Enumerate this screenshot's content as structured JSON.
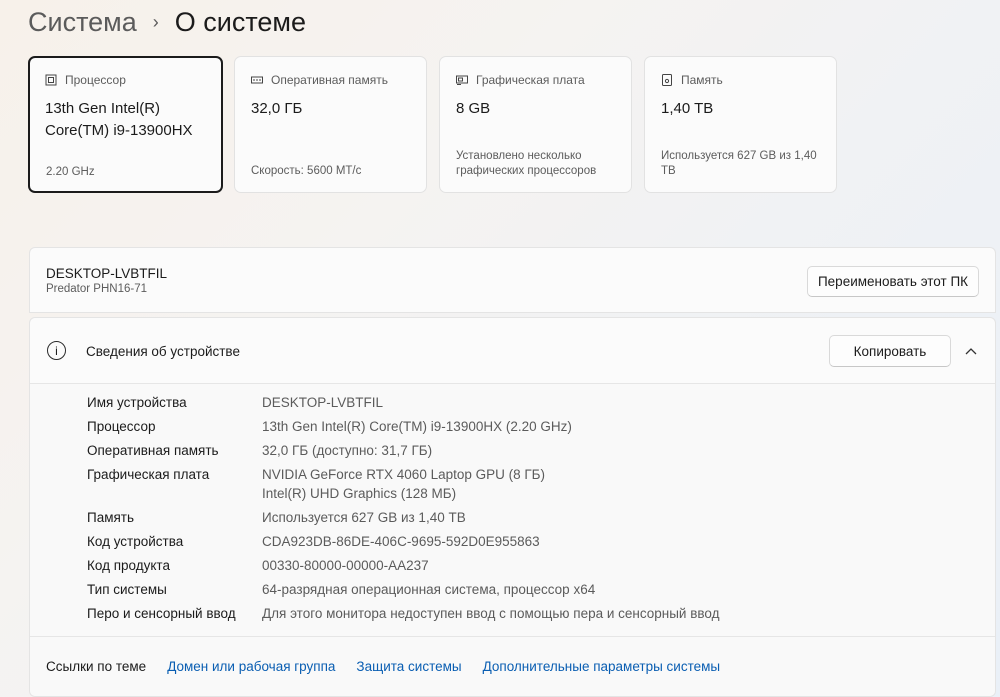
{
  "breadcrumb": {
    "parent": "Система",
    "separator": "›",
    "current": "О системе"
  },
  "specs_cards": [
    {
      "label": "Процессор",
      "icon": "cpu-icon",
      "value_line1": "13th Gen Intel(R)",
      "value_line2": "Core(TM) i9-13900HX",
      "sub_line1": "2.20 GHz",
      "sub_line2": ""
    },
    {
      "label": "Оперативная память",
      "icon": "ram-icon",
      "value_line1": "32,0 ГБ",
      "value_line2": "",
      "sub_line1": "Скорость: 5600 МТ/с",
      "sub_line2": ""
    },
    {
      "label": "Графическая плата",
      "icon": "gpu-icon",
      "value_line1": "8 GB",
      "value_line2": "",
      "sub_line1": "Установлено несколько",
      "sub_line2": "графических процессоров"
    },
    {
      "label": "Память",
      "icon": "storage-icon",
      "value_line1": "1,40 TB",
      "value_line2": "",
      "sub_line1": "Используется 627 GB из 1,40",
      "sub_line2": "TB"
    }
  ],
  "device": {
    "name": "DESKTOP-LVBTFIL",
    "model": "Predator PHN16-71",
    "rename_label": "Переименовать этот ПК"
  },
  "device_info": {
    "title": "Сведения об устройстве",
    "copy_label": "Копировать",
    "rows": [
      {
        "key": "Имя устройства",
        "value": "DESKTOP-LVBTFIL",
        "value2": ""
      },
      {
        "key": "Процессор",
        "value": "13th Gen Intel(R) Core(TM) i9-13900HX (2.20 GHz)",
        "value2": ""
      },
      {
        "key": "Оперативная память",
        "value": "32,0 ГБ (доступно: 31,7 ГБ)",
        "value2": ""
      },
      {
        "key": "Графическая плата",
        "value": "NVIDIA GeForce RTX 4060 Laptop GPU (8 ГБ)",
        "value2": "Intel(R) UHD Graphics (128 МБ)"
      },
      {
        "key": "Память",
        "value": "Используется 627 GB из 1,40 TB",
        "value2": ""
      },
      {
        "key": "Код устройства",
        "value": "CDA923DB-86DE-406C-9695-592D0E955863",
        "value2": ""
      },
      {
        "key": "Код продукта",
        "value": "00330-80000-00000-AA237",
        "value2": ""
      },
      {
        "key": "Тип системы",
        "value": "64-разрядная операционная система, процессор x64",
        "value2": ""
      },
      {
        "key": "Перо и сенсорный ввод",
        "value": "Для этого монитора недоступен ввод с помощью пера и сенсорный ввод",
        "value2": ""
      }
    ]
  },
  "related_links": {
    "title": "Ссылки по теме",
    "items": [
      "Домен или рабочая группа",
      "Защита системы",
      "Дополнительные параметры системы"
    ]
  },
  "colors": {
    "link": "#0a5eb2",
    "text_primary": "#1b1b1b",
    "text_secondary": "#5c5c5c"
  }
}
